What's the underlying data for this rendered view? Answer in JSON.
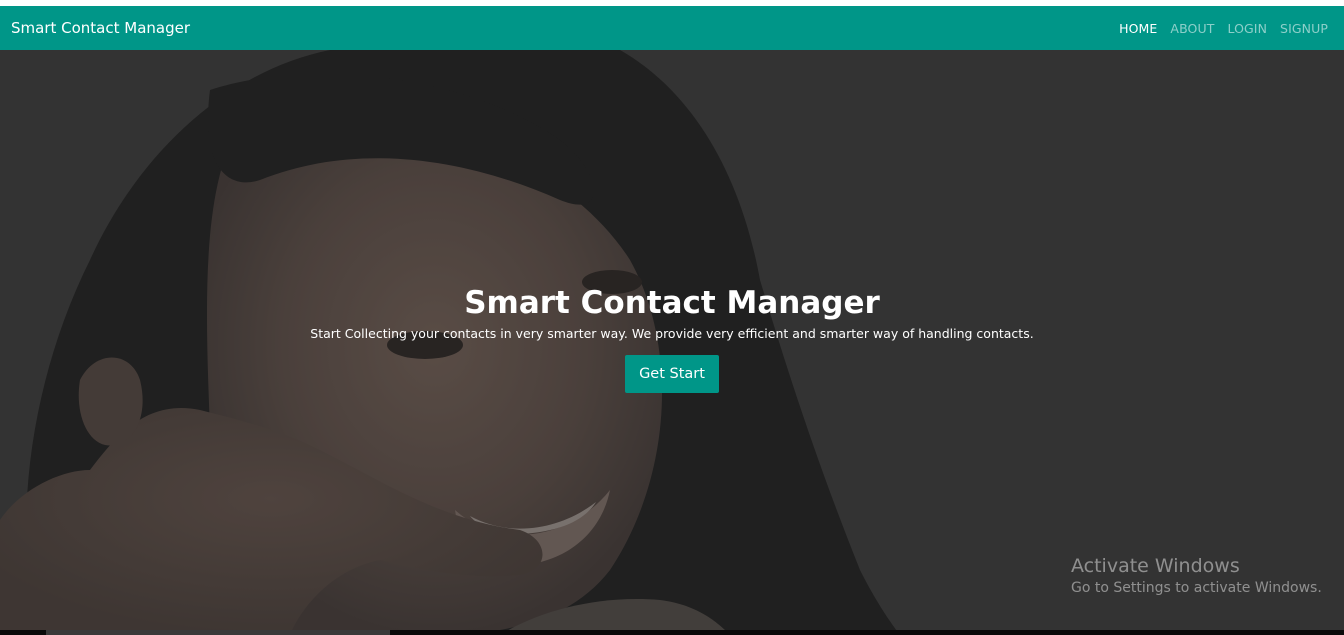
{
  "navbar": {
    "brand": "Smart Contact Manager",
    "links": [
      {
        "label": "HOME",
        "active": true
      },
      {
        "label": "ABOUT",
        "active": false
      },
      {
        "label": "LOGIN",
        "active": false
      },
      {
        "label": "SIGNUP",
        "active": false
      }
    ]
  },
  "hero": {
    "title": "Smart Contact Manager",
    "subtitle": "Start Collecting your contacts in very smarter way. We provide very efficient and smarter way of handling contacts.",
    "button_label": "Get Start"
  },
  "watermark": {
    "title": "Activate Windows",
    "subtitle": "Go to Settings to activate Windows."
  },
  "colors": {
    "primary": "#009688",
    "hero_bg": "#333333"
  }
}
